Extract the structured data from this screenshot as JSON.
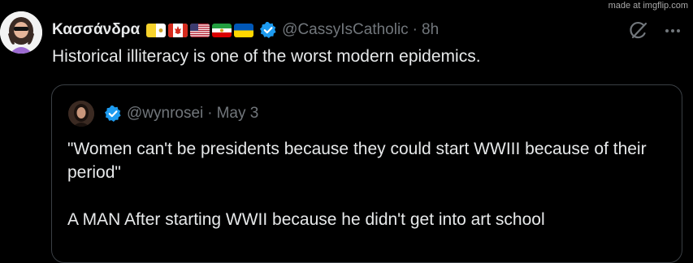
{
  "watermark": "made at imgflip.com",
  "tweet": {
    "display_name": "Κασσάνδρα",
    "flags": [
      "vatican-flag-icon",
      "canada-flag-icon",
      "usa-flag-icon",
      "iran-lion-sun-flag-icon",
      "ukraine-flag-icon"
    ],
    "handle": "@CassyIsCatholic",
    "separator": "·",
    "timestamp": "8h",
    "text": "Historical illiteracy is one of the worst modern epidemics.",
    "icons": [
      "grok-icon",
      "more-icon"
    ]
  },
  "quote": {
    "handle": "@wynrosei",
    "separator": "·",
    "date": "May 3",
    "paragraph_1": "\"Women can't be presidents because they could start WWIII because of their period\"",
    "paragraph_2": "A MAN After starting WWII because he didn't get into art school"
  },
  "colors": {
    "background": "#000000",
    "text_primary": "#e7e9ea",
    "text_secondary": "#71767b",
    "verified_blue": "#1d9bf0",
    "card_border": "#3a3f44"
  }
}
